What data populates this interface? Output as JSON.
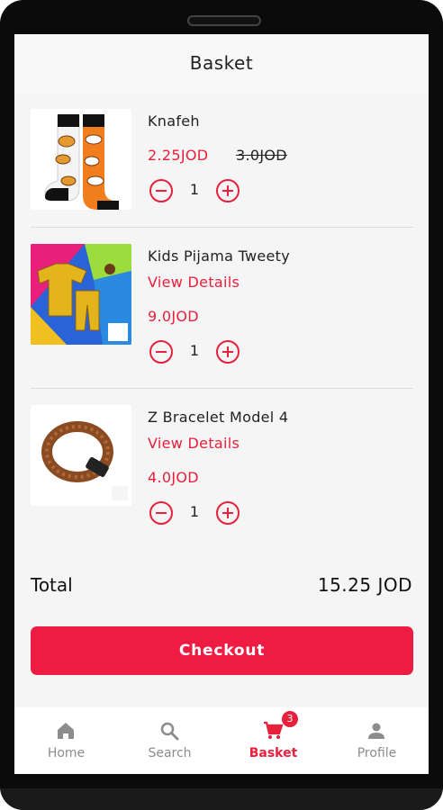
{
  "header": {
    "title": "Basket"
  },
  "items": [
    {
      "name": "Knafeh",
      "price": "2.25JOD",
      "old_price": "3.0JOD",
      "quantity": "1",
      "image": "socks-product-image"
    },
    {
      "name": "Kids Pijama Tweety",
      "link": "View Details",
      "price": "9.0JOD",
      "quantity": "1",
      "image": "pajama-product-image"
    },
    {
      "name": "Z Bracelet Model 4",
      "link": "View Details",
      "price": "4.0JOD",
      "quantity": "1",
      "image": "bracelet-product-image"
    }
  ],
  "summary": {
    "total_label": "Total",
    "total_value": "15.25 JOD"
  },
  "checkout": {
    "label": "Checkout"
  },
  "nav": {
    "items": [
      {
        "label": "Home",
        "icon": "home-icon"
      },
      {
        "label": "Search",
        "icon": "search-icon"
      },
      {
        "label": "Basket",
        "icon": "cart-icon",
        "badge": "3",
        "active": true
      },
      {
        "label": "Profile",
        "icon": "person-icon"
      }
    ]
  },
  "colors": {
    "accent": "#e8203c",
    "button": "#ee1c42",
    "muted": "#8c8c8c"
  }
}
